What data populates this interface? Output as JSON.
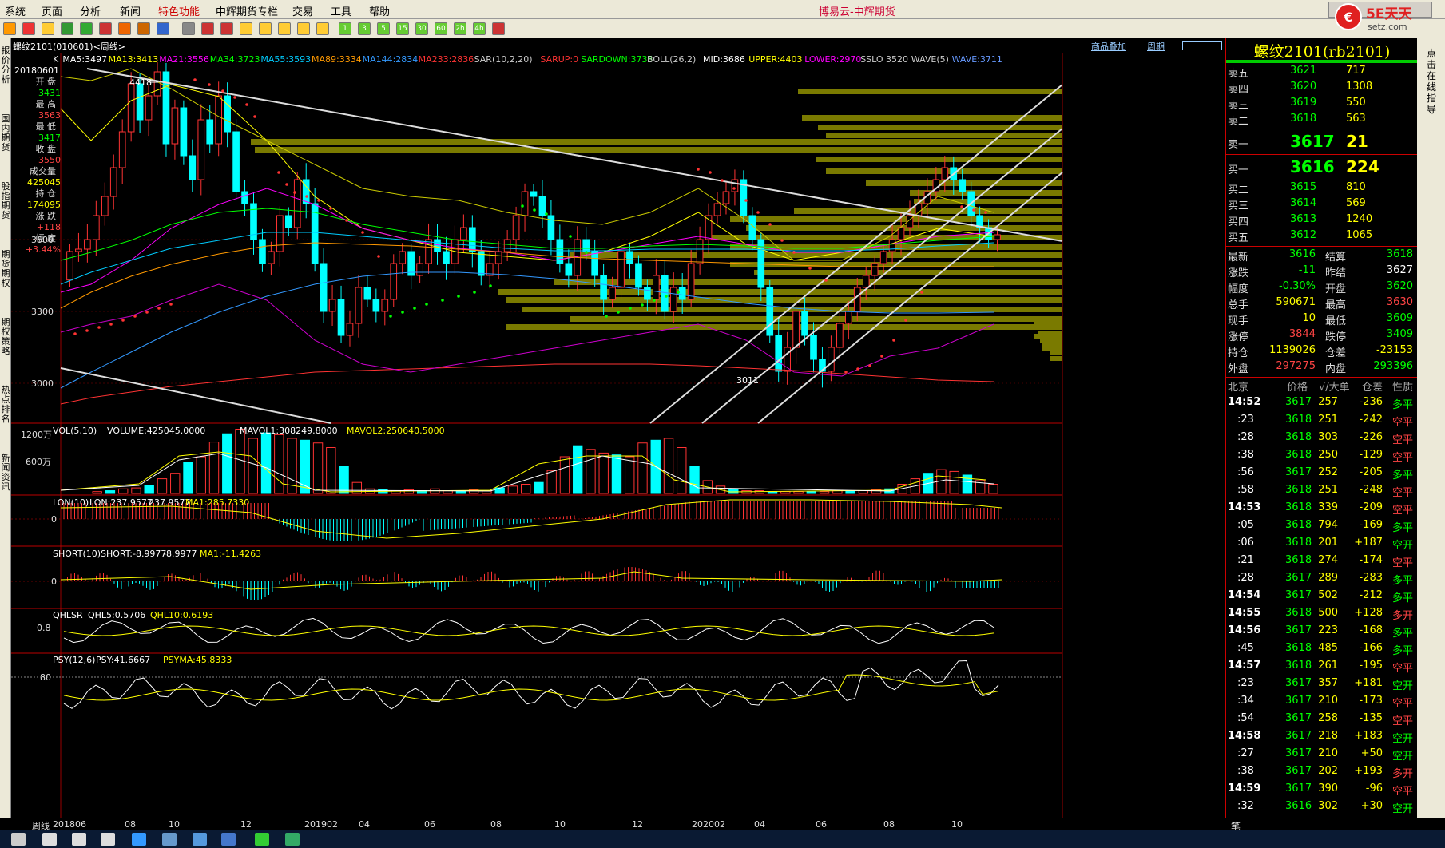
{
  "menu": [
    "系统",
    "页面",
    "分析",
    "新闻",
    "特色功能",
    "中辉期货专栏",
    "交易",
    "工具",
    "帮助"
  ],
  "app_title": "博易云-中辉期货",
  "logo": {
    "text": "5E天天",
    "sub": "setz.com"
  },
  "toolbar_icons": [
    "back-icon",
    "home-icon",
    "folder-icon",
    "refresh-icon",
    "copy-icon",
    "pen-icon",
    "coin-icon",
    "filter-icon",
    "news-icon",
    "grid-icon",
    "chart-icon",
    "tick-icon",
    "day-icon",
    "week-icon",
    "month-icon",
    "season-icon",
    "year-icon",
    "p1-icon",
    "p3-icon",
    "p5-icon",
    "p15-icon",
    "p30-icon",
    "p60-icon",
    "p2h-icon",
    "p4h-icon",
    "calc-icon"
  ],
  "toolbar_labels": [
    "1",
    "3",
    "5",
    "15",
    "30",
    "60",
    "2h",
    "4h"
  ],
  "chart_header": {
    "symbol": "螺纹2101(010601)<周线>",
    "overlay": "商品叠加",
    "period": "周期"
  },
  "sidebar": [
    "报价分析",
    "国内期货",
    "股指期货",
    "期货期权",
    "期权策略",
    "热点排名",
    "新闻资讯"
  ],
  "ohlc": {
    "date": "20180601",
    "open_label": "开 盘",
    "open": "3431",
    "high_label": "最 高",
    "high": "3563",
    "low_label": "最 低",
    "low": "3417",
    "close_label": "收 盘",
    "close": "3550",
    "volume_label": "成交量",
    "volume": "425045",
    "oi_label": "持 仓",
    "oi": "174095",
    "change_label": "涨 跌",
    "change": "+118",
    "pct_label": "幅 度",
    "pct": "+3.44%"
  },
  "main_indicators": [
    {
      "text": "K",
      "color": "#ffffff"
    },
    {
      "text": "MA5:3497",
      "color": "#ffffff"
    },
    {
      "text": "MA13:3413",
      "color": "#ffff00"
    },
    {
      "text": "MA21:3556",
      "color": "#ff00ff"
    },
    {
      "text": "MA34:3723",
      "color": "#00ff00"
    },
    {
      "text": "MA55:3593",
      "color": "#00ccff"
    },
    {
      "text": "MA89:3334",
      "color": "#ff9900"
    },
    {
      "text": "MA144:2834",
      "color": "#3399ff"
    },
    {
      "text": "MA233:2836",
      "color": "#ff3333"
    },
    {
      "text": "SAR(10,2,20)",
      "color": "#cccccc"
    },
    {
      "text": "SARUP:0",
      "color": "#ff3333"
    },
    {
      "text": "SARDOWN:3735",
      "color": "#00ff00"
    },
    {
      "text": "BOLL(26,2)",
      "color": "#cccccc"
    },
    {
      "text": "MID:3686",
      "color": "#ffffff"
    },
    {
      "text": "UPPER:4403",
      "color": "#ffff00"
    },
    {
      "text": "LOWER:2970",
      "color": "#ff00ff"
    },
    {
      "text": "SSLO 3520",
      "color": "#cccccc"
    },
    {
      "text": "WAVE(5)",
      "color": "#cccccc"
    },
    {
      "text": "WAVE:3711",
      "color": "#6699ff"
    }
  ],
  "main_price_labels": [
    "3600",
    "3300",
    "3000"
  ],
  "annotations": {
    "high": "4418",
    "low": "3011"
  },
  "vol_panel": {
    "title": "VOL(5,10)",
    "v1": "VOLUME:425045.0000",
    "v2": "MAVOL1:308249.8000",
    "v3": "MAVOL2:250640.5000",
    "ticks": [
      "1200万",
      "600万"
    ]
  },
  "lon_panel": {
    "title": "LON(10)",
    "v1": "LON:237.9577",
    "v2": "237.9577",
    "v3": "MA1:285.7330",
    "tick": "0"
  },
  "short_panel": {
    "title": "SHORT(10)",
    "v1": "SHORT:-8.9977",
    "v2": "-8.9977",
    "v3": "MA1:-11.4263",
    "tick": "0"
  },
  "qhlsr_panel": {
    "title": "QHLSR",
    "v1": "QHL5:0.5706",
    "v2": "QHL10:0.6193",
    "tick": "0.8"
  },
  "psy_panel": {
    "title": "PSY(12,6)",
    "v1": "PSY:41.6667",
    "v2": "PSYMA:45.8333",
    "tick": "80"
  },
  "date_axis": [
    "周线",
    "201806",
    "08",
    "10",
    "12",
    "201902",
    "04",
    "06",
    "08",
    "10",
    "12",
    "202002",
    "04",
    "06",
    "08",
    "10"
  ],
  "quote": {
    "title": "螺纹2101(rb2101)",
    "asks": [
      {
        "name": "卖五",
        "price": "3621",
        "vol": "717"
      },
      {
        "name": "卖四",
        "price": "3620",
        "vol": "1308"
      },
      {
        "name": "卖三",
        "price": "3619",
        "vol": "550"
      },
      {
        "name": "卖二",
        "price": "3618",
        "vol": "563"
      },
      {
        "name": "卖一",
        "price": "3617",
        "vol": "21"
      }
    ],
    "bids": [
      {
        "name": "买一",
        "price": "3616",
        "vol": "224"
      },
      {
        "name": "买二",
        "price": "3615",
        "vol": "810"
      },
      {
        "name": "买三",
        "price": "3614",
        "vol": "569"
      },
      {
        "name": "买四",
        "price": "3613",
        "vol": "1240"
      },
      {
        "name": "买五",
        "price": "3612",
        "vol": "1065"
      }
    ],
    "stats": [
      {
        "l1": "最新",
        "v1": "3616",
        "c1": "#00ff00",
        "l2": "结算",
        "v2": "3618",
        "c2": "#00ff00"
      },
      {
        "l1": "涨跌",
        "v1": "-11",
        "c1": "#00ff00",
        "l2": "昨结",
        "v2": "3627",
        "c2": "#ffffff"
      },
      {
        "l1": "幅度",
        "v1": "-0.30%",
        "c1": "#00ff00",
        "l2": "开盘",
        "v2": "3620",
        "c2": "#00ff00"
      },
      {
        "l1": "总手",
        "v1": "590671",
        "c1": "#ffff00",
        "l2": "最高",
        "v2": "3630",
        "c2": "#ff4444"
      },
      {
        "l1": "现手",
        "v1": "10",
        "c1": "#ffff00",
        "l2": "最低",
        "v2": "3609",
        "c2": "#00ff00"
      },
      {
        "l1": "涨停",
        "v1": "3844",
        "c1": "#ff4444",
        "l2": "跌停",
        "v2": "3409",
        "c2": "#00ff00"
      },
      {
        "l1": "持仓",
        "v1": "1139026",
        "c1": "#ffff00",
        "l2": "仓差",
        "v2": "-23153",
        "c2": "#ffff00"
      },
      {
        "l1": "外盘",
        "v1": "297275",
        "c1": "#ff4444",
        "l2": "内盘",
        "v2": "293396",
        "c2": "#00ff00"
      }
    ],
    "ticks_header": [
      "北京",
      "价格",
      "√/大单",
      "仓差",
      "性质"
    ],
    "ticks": [
      {
        "t": "14:52",
        "p": "3617",
        "v": "257",
        "d": "-236",
        "k": "多平",
        "kc": "#00ff00",
        "bold": true
      },
      {
        "t": ":23",
        "p": "3618",
        "v": "251",
        "d": "-242",
        "k": "空平",
        "kc": "#ff4444",
        "bold": false
      },
      {
        "t": ":28",
        "p": "3618",
        "v": "303",
        "d": "-226",
        "k": "空平",
        "kc": "#ff4444",
        "bold": false
      },
      {
        "t": ":38",
        "p": "3618",
        "v": "250",
        "d": "-129",
        "k": "空平",
        "kc": "#ff4444",
        "bold": false
      },
      {
        "t": ":56",
        "p": "3617",
        "v": "252",
        "d": "-205",
        "k": "多平",
        "kc": "#00ff00",
        "bold": false
      },
      {
        "t": ":58",
        "p": "3618",
        "v": "251",
        "d": "-248",
        "k": "空平",
        "kc": "#ff4444",
        "bold": false
      },
      {
        "t": "14:53",
        "p": "3618",
        "v": "339",
        "d": "-209",
        "k": "空平",
        "kc": "#ff4444",
        "bold": true
      },
      {
        "t": ":05",
        "p": "3618",
        "v": "794",
        "d": "-169",
        "k": "多平",
        "kc": "#00ff00",
        "bold": false
      },
      {
        "t": ":06",
        "p": "3618",
        "v": "201",
        "d": "+187",
        "k": "空开",
        "kc": "#00ff00",
        "bold": false
      },
      {
        "t": ":21",
        "p": "3618",
        "v": "274",
        "d": "-174",
        "k": "空平",
        "kc": "#ff4444",
        "bold": false
      },
      {
        "t": ":28",
        "p": "3617",
        "v": "289",
        "d": "-283",
        "k": "多平",
        "kc": "#00ff00",
        "bold": false
      },
      {
        "t": "14:54",
        "p": "3617",
        "v": "502",
        "d": "-212",
        "k": "多平",
        "kc": "#00ff00",
        "bold": true
      },
      {
        "t": "14:55",
        "p": "3618",
        "v": "500",
        "d": "+128",
        "k": "多开",
        "kc": "#ff4444",
        "bold": true
      },
      {
        "t": "14:56",
        "p": "3617",
        "v": "223",
        "d": "-168",
        "k": "多平",
        "kc": "#00ff00",
        "bold": true
      },
      {
        "t": ":45",
        "p": "3618",
        "v": "485",
        "d": "-166",
        "k": "多平",
        "kc": "#00ff00",
        "bold": false
      },
      {
        "t": "14:57",
        "p": "3618",
        "v": "261",
        "d": "-195",
        "k": "空平",
        "kc": "#ff4444",
        "bold": true
      },
      {
        "t": ":23",
        "p": "3617",
        "v": "357",
        "d": "+181",
        "k": "空开",
        "kc": "#00ff00",
        "bold": false
      },
      {
        "t": ":34",
        "p": "3617",
        "v": "210",
        "d": "-173",
        "k": "空平",
        "kc": "#ff4444",
        "bold": false
      },
      {
        "t": ":54",
        "p": "3617",
        "v": "258",
        "d": "-135",
        "k": "空平",
        "kc": "#ff4444",
        "bold": false
      },
      {
        "t": "14:58",
        "p": "3617",
        "v": "218",
        "d": "+183",
        "k": "空开",
        "kc": "#00ff00",
        "bold": true
      },
      {
        "t": ":27",
        "p": "3617",
        "v": "210",
        "d": "+50",
        "k": "空开",
        "kc": "#00ff00",
        "bold": false
      },
      {
        "t": ":38",
        "p": "3617",
        "v": "202",
        "d": "+193",
        "k": "多开",
        "kc": "#ff4444",
        "bold": false
      },
      {
        "t": "14:59",
        "p": "3617",
        "v": "390",
        "d": "-96",
        "k": "空平",
        "kc": "#ff4444",
        "bold": true
      },
      {
        "t": ":32",
        "p": "3616",
        "v": "302",
        "d": "+30",
        "k": "空开",
        "kc": "#00ff00",
        "bold": false
      }
    ],
    "bottom_tab": "笔"
  },
  "right_scroll_text": "点击在线指导",
  "taskbar_icons": [
    "start-icon",
    "search-icon",
    "cortana-icon",
    "taskview-icon",
    "ie-icon",
    "app1-icon",
    "app2-icon",
    "app3-icon",
    "wechat-icon",
    "excel-icon"
  ]
}
